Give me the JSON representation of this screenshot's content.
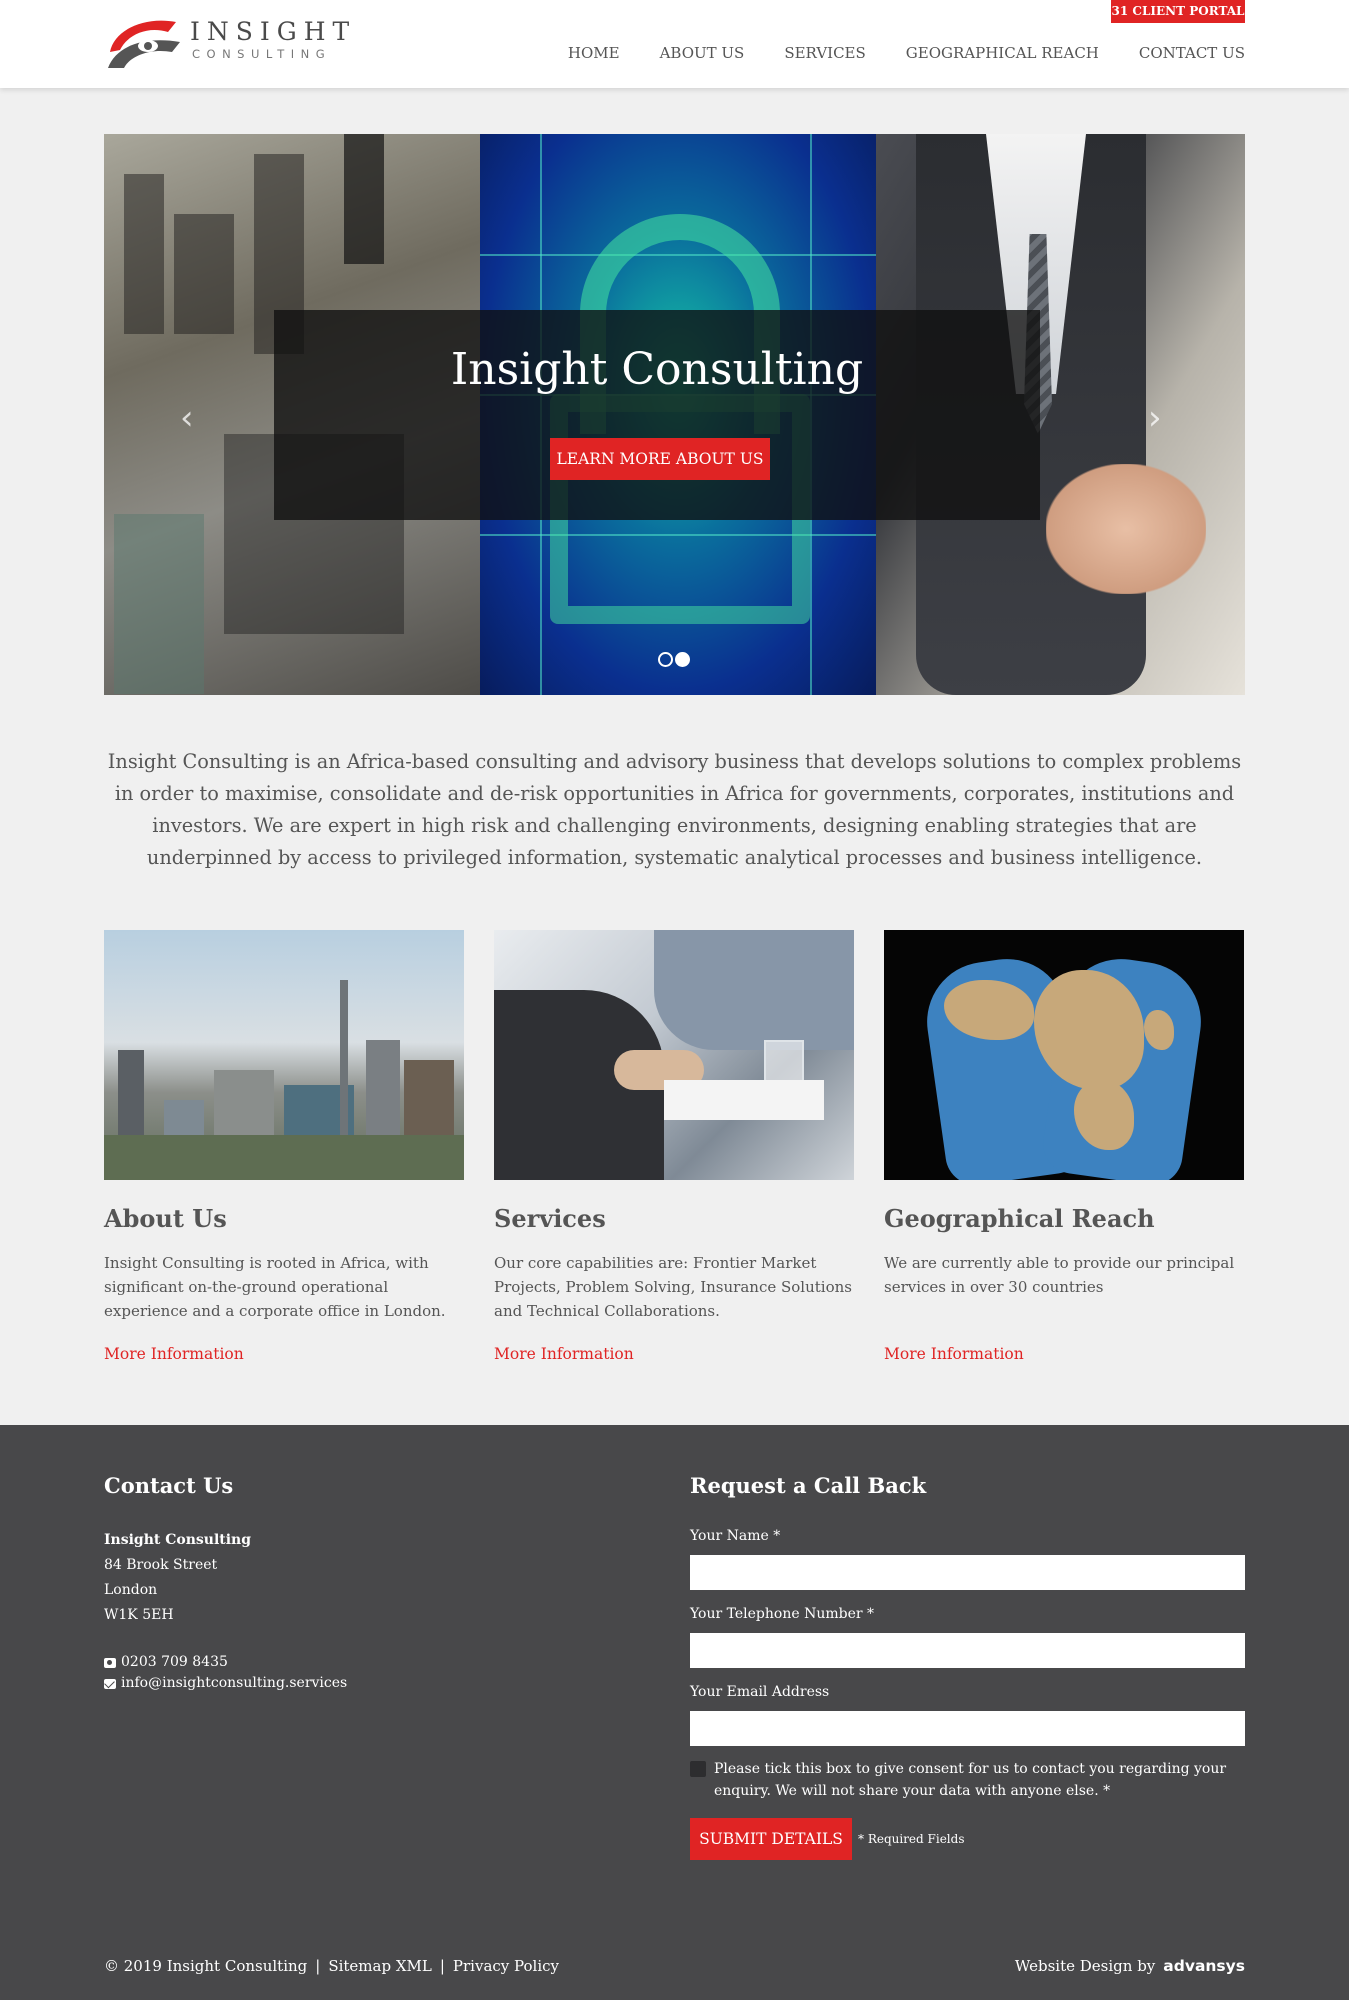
{
  "header": {
    "logo_word": "INSIGHT",
    "logo_sub": "CONSULTING",
    "portal_button": "31 CLIENT PORTAL",
    "nav": [
      "HOME",
      "ABOUT US",
      "SERVICES",
      "GEOGRAPHICAL REACH",
      "CONTACT US"
    ]
  },
  "hero": {
    "title": "Insight Consulting",
    "button": "LEARN MORE ABOUT US",
    "prev_icon": "chevron-left-icon",
    "next_icon": "chevron-right-icon",
    "slide_count": 2,
    "active_slide": 2
  },
  "intro": "Insight Consulting is an Africa-based consulting and advisory business that develops solutions to complex problems in order to maximise, consolidate and de-risk opportunities in Africa for governments, corporates, institutions and investors. We are expert in high risk and challenging environments, designing enabling strategies that are underpinned by access to privileged information, systematic analytical processes and business intelligence.",
  "cards": [
    {
      "title": "About Us",
      "text": "Insight Consulting is rooted in Africa, with significant on-the-ground operational experience and a corporate office in London.",
      "link": "More Information"
    },
    {
      "title": "Services",
      "text": "Our core capabilities are: Frontier Market Projects, Problem Solving, Insurance Solutions and Technical Collaborations.",
      "link": "More Information"
    },
    {
      "title": "Geographical Reach",
      "text": "We are currently able to provide our principal services in over 30 countries",
      "link": "More Information"
    }
  ],
  "footer": {
    "contact_heading": "Contact Us",
    "company": "Insight Consulting",
    "address": [
      "84 Brook Street",
      "London",
      "W1K 5EH"
    ],
    "phone": "0203 709 8435",
    "email": "info@insightconsulting.services",
    "form_heading": "Request a Call Back",
    "name_label": "Your Name *",
    "phone_label": "Your Telephone Number *",
    "email_label": "Your Email Address",
    "consent": "Please tick this box to give consent for us to contact you regarding your enquiry. We will not share your data with anyone else. *",
    "submit": "SUBMIT DETAILS",
    "required_note": "* Required Fields",
    "copyright": "© 2019 Insight Consulting",
    "sitemap": "Sitemap XML",
    "privacy": "Privacy Policy",
    "separator": "|",
    "credit": "Website Design by",
    "credit_brand": "advansys"
  },
  "colors": {
    "accent": "#e02424",
    "footer_bg": "#48484a",
    "page_bg": "#f0f0f0"
  }
}
